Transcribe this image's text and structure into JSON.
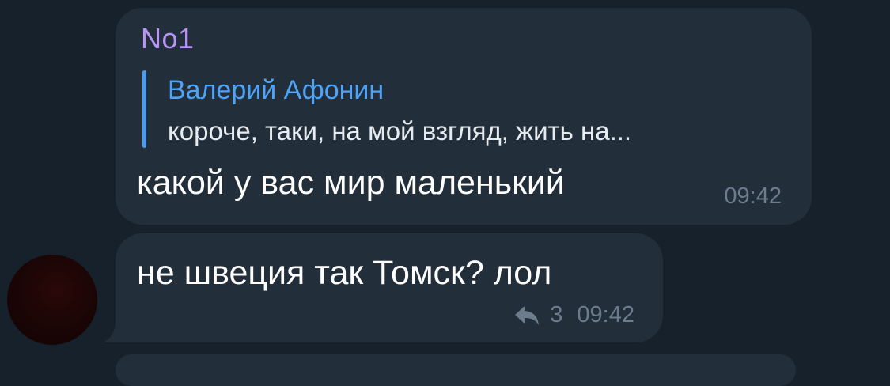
{
  "messages": [
    {
      "sender": "No1",
      "reply": {
        "author": "Валерий Афонин",
        "snippet": "короче, таки, на мой взгляд, жить на..."
      },
      "text": "какой у вас мир маленький",
      "time": "09:42"
    },
    {
      "text": "не швеция так Томск? лол",
      "reply_count": "3",
      "time": "09:42"
    }
  ],
  "colors": {
    "background": "#17212b",
    "bubble": "#222e3a",
    "sender_name": "#b794f6",
    "reply_accent": "#4fa3f7",
    "meta": "#6c7c8c"
  }
}
